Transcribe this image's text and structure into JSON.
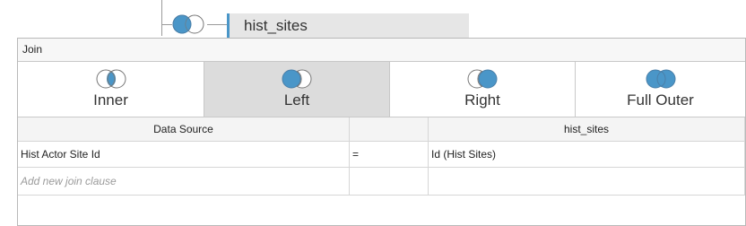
{
  "canvas": {
    "table_name": "hist_sites"
  },
  "dialog": {
    "title": "Join",
    "join_types": [
      {
        "label": "Inner",
        "icon": "inner-join-icon",
        "selected": false
      },
      {
        "label": "Left",
        "icon": "left-join-icon",
        "selected": true
      },
      {
        "label": "Right",
        "icon": "right-join-icon",
        "selected": false
      },
      {
        "label": "Full Outer",
        "icon": "full-outer-join-icon",
        "selected": false
      }
    ],
    "grid": {
      "headers": [
        "Data Source",
        "",
        "hist_sites"
      ],
      "clauses": [
        {
          "left": "Hist Actor Site Id",
          "operator": "=",
          "right": "Id (Hist Sites)"
        }
      ],
      "add_placeholder": "Add new join clause"
    }
  },
  "colors": {
    "accent": "#4a96c8",
    "selected_bg": "#dcdcdc"
  }
}
